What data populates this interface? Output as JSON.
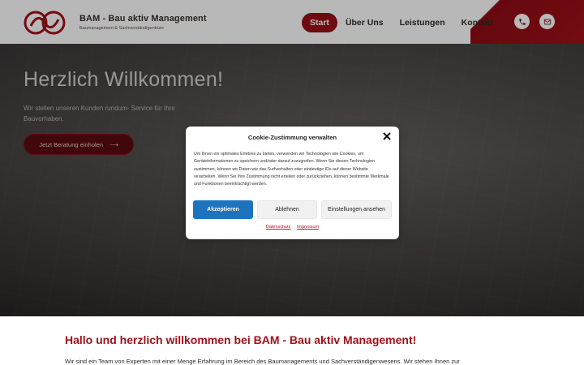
{
  "header": {
    "brand_title": "BAM - Bau aktiv Management",
    "brand_subtitle": "Baumanagement & Sachverständigenbüro",
    "nav": [
      "Start",
      "Über Uns",
      "Leistungen",
      "Kontakt"
    ],
    "icons": [
      "phone-icon",
      "mail-icon"
    ],
    "accent_color": "#9a0f18"
  },
  "hero": {
    "title": "Herzlich Willkommen!",
    "text": "Wir stellen unseren Kunden rundum- Service für Ihre Bauvorhaben.",
    "cta_label": "Jetzt Beratung einholen",
    "cta_arrow": "⟶"
  },
  "cookie_modal": {
    "title": "Cookie-Zustimmung verwalten",
    "text": "Um Ihnen ein optimales Erlebnis zu bieten, verwenden wir Technologien wie Cookies, um Geräteinformationen zu speichern und/oder darauf zuzugreifen. Wenn Sie diesen Technologien zustimmen, können wir Daten wie das Surfverhalten oder eindeutige IDs auf dieser Website verarbeiten. Wenn Sie Ihre Zustimmung nicht erteilen oder zurückziehen, können bestimmte Merkmale und Funktionen beeinträchtigt werden.",
    "accept_label": "Akzeptieren",
    "deny_label": "Ablehnen",
    "settings_label": "Einstellungen ansehen",
    "privacy_link": "Datenschutz",
    "imprint_link": "Impressum",
    "accept_color": "#1e73be"
  },
  "welcome": {
    "title": "Hallo und herzlich willkommen bei BAM - Bau aktiv Management!",
    "text": "Wir sind ein Team von Experten mit einer Menge Erfahrung im Bereich des Baumanagements und Sachverständigenwesens. Wir stehen Ihnen zur"
  }
}
